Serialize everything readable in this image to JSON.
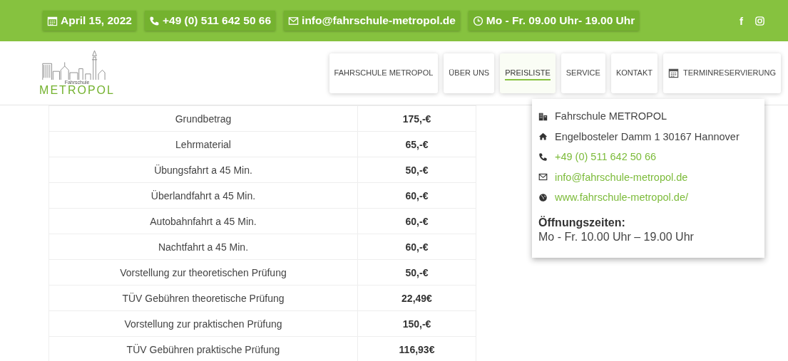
{
  "top_bar": {
    "items": [
      {
        "kind": "calendar",
        "text": "April 15, 2022"
      },
      {
        "kind": "phone",
        "text": "+49 (0) 511 642 50 66"
      },
      {
        "kind": "mail",
        "text": "info@fahrschule-metropol.de"
      },
      {
        "kind": "clock",
        "text": "Mo - Fr. 09.00 Uhr- 19.00 Uhr"
      }
    ],
    "social": [
      {
        "kind": "facebook",
        "text": "f"
      },
      {
        "kind": "instagram"
      }
    ]
  },
  "logo": {
    "small": "Fahrschule",
    "name": "METROPOL"
  },
  "nav": [
    {
      "kind": "text",
      "label": "FAHRSCHULE METROPOL",
      "selected": false
    },
    {
      "kind": "text",
      "label": "ÜBER UNS",
      "selected": false
    },
    {
      "kind": "text",
      "label": "PREISLISTE",
      "selected": true
    },
    {
      "kind": "text",
      "label": "SERVICE",
      "selected": false
    },
    {
      "kind": "text",
      "label": "KONTAKT",
      "selected": false
    },
    {
      "kind": "calendar",
      "label": "TERMINRESERVIERUNG",
      "selected": false
    }
  ],
  "price_table": {
    "rows": [
      {
        "item": "Grundbetrag",
        "price": "175,-€"
      },
      {
        "item": "Lehrmaterial",
        "price": "65,-€"
      },
      {
        "item": "Übungsfahrt a 45 Min.",
        "price": "50,-€"
      },
      {
        "item": "Überlandfahrt a 45 Min.",
        "price": "60,-€"
      },
      {
        "item": "Autobahnfahrt a 45 Min.",
        "price": "60,-€"
      },
      {
        "item": "Nachtfahrt a 45 Min.",
        "price": "60,-€"
      },
      {
        "item": "Vorstellung zur theoretischen Prüfung",
        "price": "50,-€"
      },
      {
        "item": "TÜV Gebühren theoretische Prüfung",
        "price": "22,49€"
      },
      {
        "item": "Vorstellung zur praktischen Prüfung",
        "price": "150,-€"
      },
      {
        "item": "TÜV Gebühren praktische Prüfung",
        "price": "116,93€"
      }
    ]
  },
  "contact_card": {
    "items": [
      {
        "kind": "building",
        "text": "Fahrschule METROPOL",
        "link": false
      },
      {
        "kind": "home",
        "text": "Engelbosteler Damm 1 30167 Hannover",
        "link": false
      },
      {
        "kind": "phone",
        "text": "+49 (0) 511 642 50 66",
        "link": true
      },
      {
        "kind": "mail",
        "text": "info@fahrschule-metropol.de",
        "link": true
      },
      {
        "kind": "globe",
        "text": "www.fahrschule-metropol.de/",
        "link": true
      }
    ],
    "hours_title": "Öffnungszeiten:",
    "hours": "Mo - Fr. 10.00 Uhr – 19.00 Uhr"
  }
}
